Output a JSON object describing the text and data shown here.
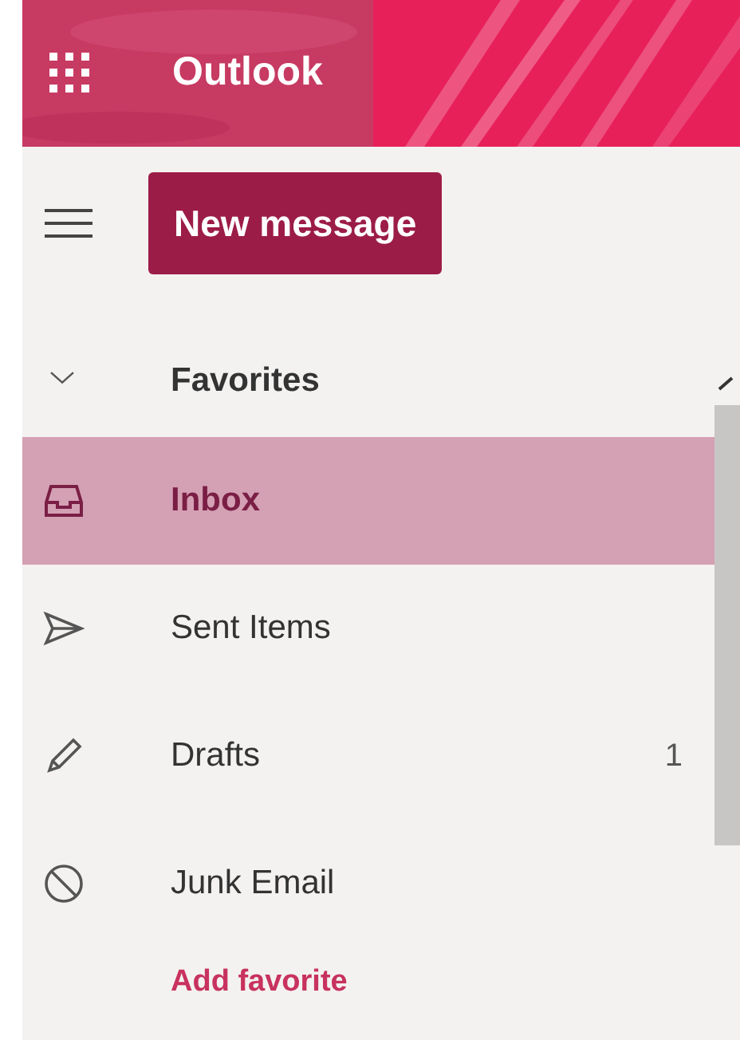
{
  "header": {
    "app_name": "Outlook"
  },
  "toolbar": {
    "new_button": "New message"
  },
  "favorites": {
    "label": "Favorites",
    "expanded": true,
    "items": [
      {
        "kind": "inbox",
        "label": "Inbox",
        "selected": true
      },
      {
        "kind": "sent",
        "label": "Sent Items",
        "selected": false
      },
      {
        "kind": "drafts",
        "label": "Drafts",
        "count": "1",
        "selected": false
      },
      {
        "kind": "junk",
        "label": "Junk Email",
        "selected": false
      }
    ],
    "add_link": "Add favorite"
  }
}
